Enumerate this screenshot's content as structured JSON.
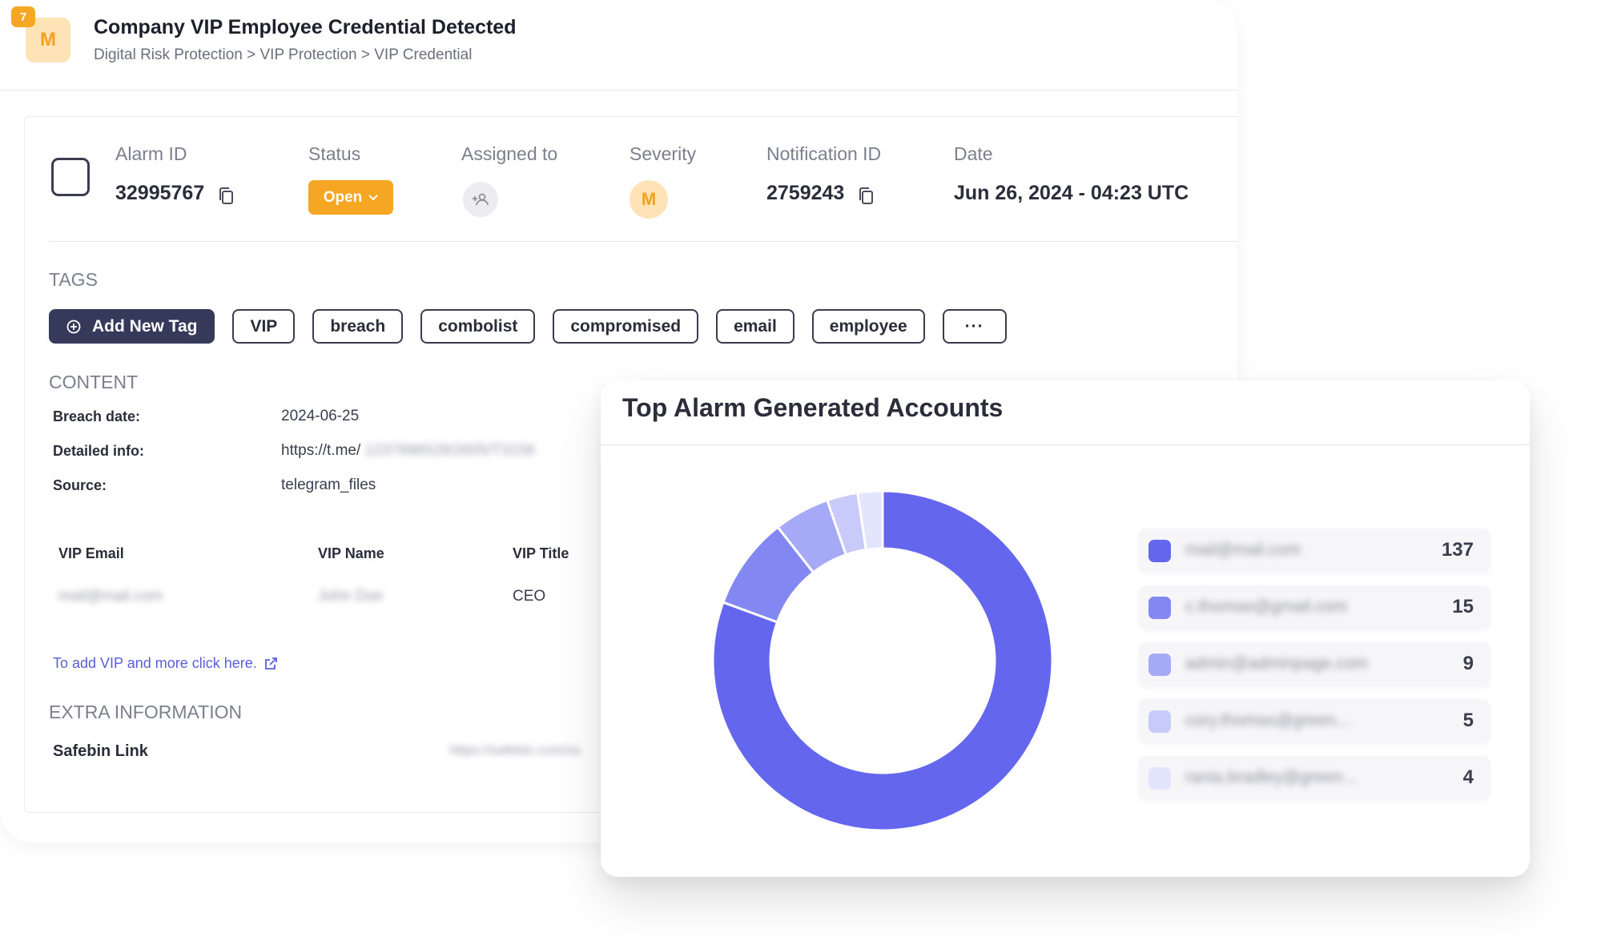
{
  "header": {
    "avatar_letter": "M",
    "notification_count": "7",
    "title": "Company VIP Employee Credential Detected",
    "breadcrumb": "Digital Risk Protection > VIP Protection > VIP Credential"
  },
  "summary": {
    "alarm_id_label": "Alarm ID",
    "alarm_id": "32995767",
    "status_label": "Status",
    "status_value": "Open",
    "assigned_label": "Assigned to",
    "severity_label": "Severity",
    "severity_letter": "M",
    "notification_id_label": "Notification ID",
    "notification_id": "2759243",
    "date_label": "Date",
    "date": "Jun 26, 2024 - 04:23 UTC"
  },
  "tags": {
    "section_title": "TAGS",
    "add_label": "Add New Tag",
    "items": [
      "VIP",
      "breach",
      "combolist",
      "compromised",
      "email",
      "employee"
    ],
    "more_label": "···"
  },
  "content": {
    "section_title": "CONTENT",
    "rows": [
      {
        "label": "Breach date:",
        "value": "2024-06-25"
      },
      {
        "label": "Detailed info:",
        "value": "https://t.me/",
        "blurred": "1237896528/2605/T3156"
      },
      {
        "label": "Source:",
        "value": "telegram_files"
      }
    ],
    "vip_headers": [
      "VIP Email",
      "VIP Name",
      "VIP Title"
    ],
    "vip_row": {
      "email": "mail@mail.com",
      "name": "John Doe",
      "title": "CEO"
    },
    "vip_link": "To add VIP and more click here."
  },
  "extra": {
    "section_title": "EXTRA INFORMATION",
    "safebin_label": "Safebin Link",
    "safebin_value": "https://safebin.com/ss"
  },
  "chart": {
    "title": "Top Alarm Generated Accounts"
  },
  "chart_data": {
    "type": "pie",
    "title": "Top Alarm Generated Accounts",
    "donut": true,
    "categories": [
      "mail@mail.com",
      "c.thomas@gmail.com",
      "admin@adminpage.com",
      "cory.thomas@green...",
      "rania.bradley@green..."
    ],
    "values": [
      137,
      15,
      9,
      5,
      4
    ],
    "colors": [
      "#6467ee",
      "#8287f2",
      "#a5a9f6",
      "#c8cbfa",
      "#e3e5fc"
    ]
  }
}
